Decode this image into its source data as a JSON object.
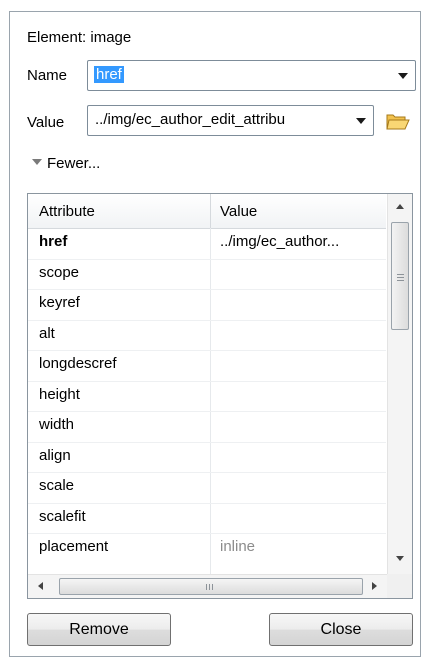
{
  "header": {
    "title": "Element: image"
  },
  "name_field": {
    "label": "Name",
    "value": "href"
  },
  "value_field": {
    "label": "Value",
    "value": "../img/ec_author_edit_attribu"
  },
  "toggle": {
    "label": "Fewer..."
  },
  "table": {
    "columns": [
      "Attribute",
      "Value"
    ],
    "rows": [
      {
        "attribute": "href",
        "value": "../img/ec_author...",
        "bold": true
      },
      {
        "attribute": "scope",
        "value": ""
      },
      {
        "attribute": "keyref",
        "value": ""
      },
      {
        "attribute": "alt",
        "value": ""
      },
      {
        "attribute": "longdescref",
        "value": ""
      },
      {
        "attribute": "height",
        "value": ""
      },
      {
        "attribute": "width",
        "value": ""
      },
      {
        "attribute": "align",
        "value": ""
      },
      {
        "attribute": "scale",
        "value": ""
      },
      {
        "attribute": "scalefit",
        "value": ""
      },
      {
        "attribute": "placement",
        "value": "inline",
        "default": true
      }
    ]
  },
  "buttons": {
    "remove": "Remove",
    "close": "Close"
  },
  "colors": {
    "selection": "#3399ff",
    "default_value_text": "#8c8c8c"
  },
  "icons": {
    "browse": "folder-open-icon",
    "expand": "triangle-down-icon"
  }
}
